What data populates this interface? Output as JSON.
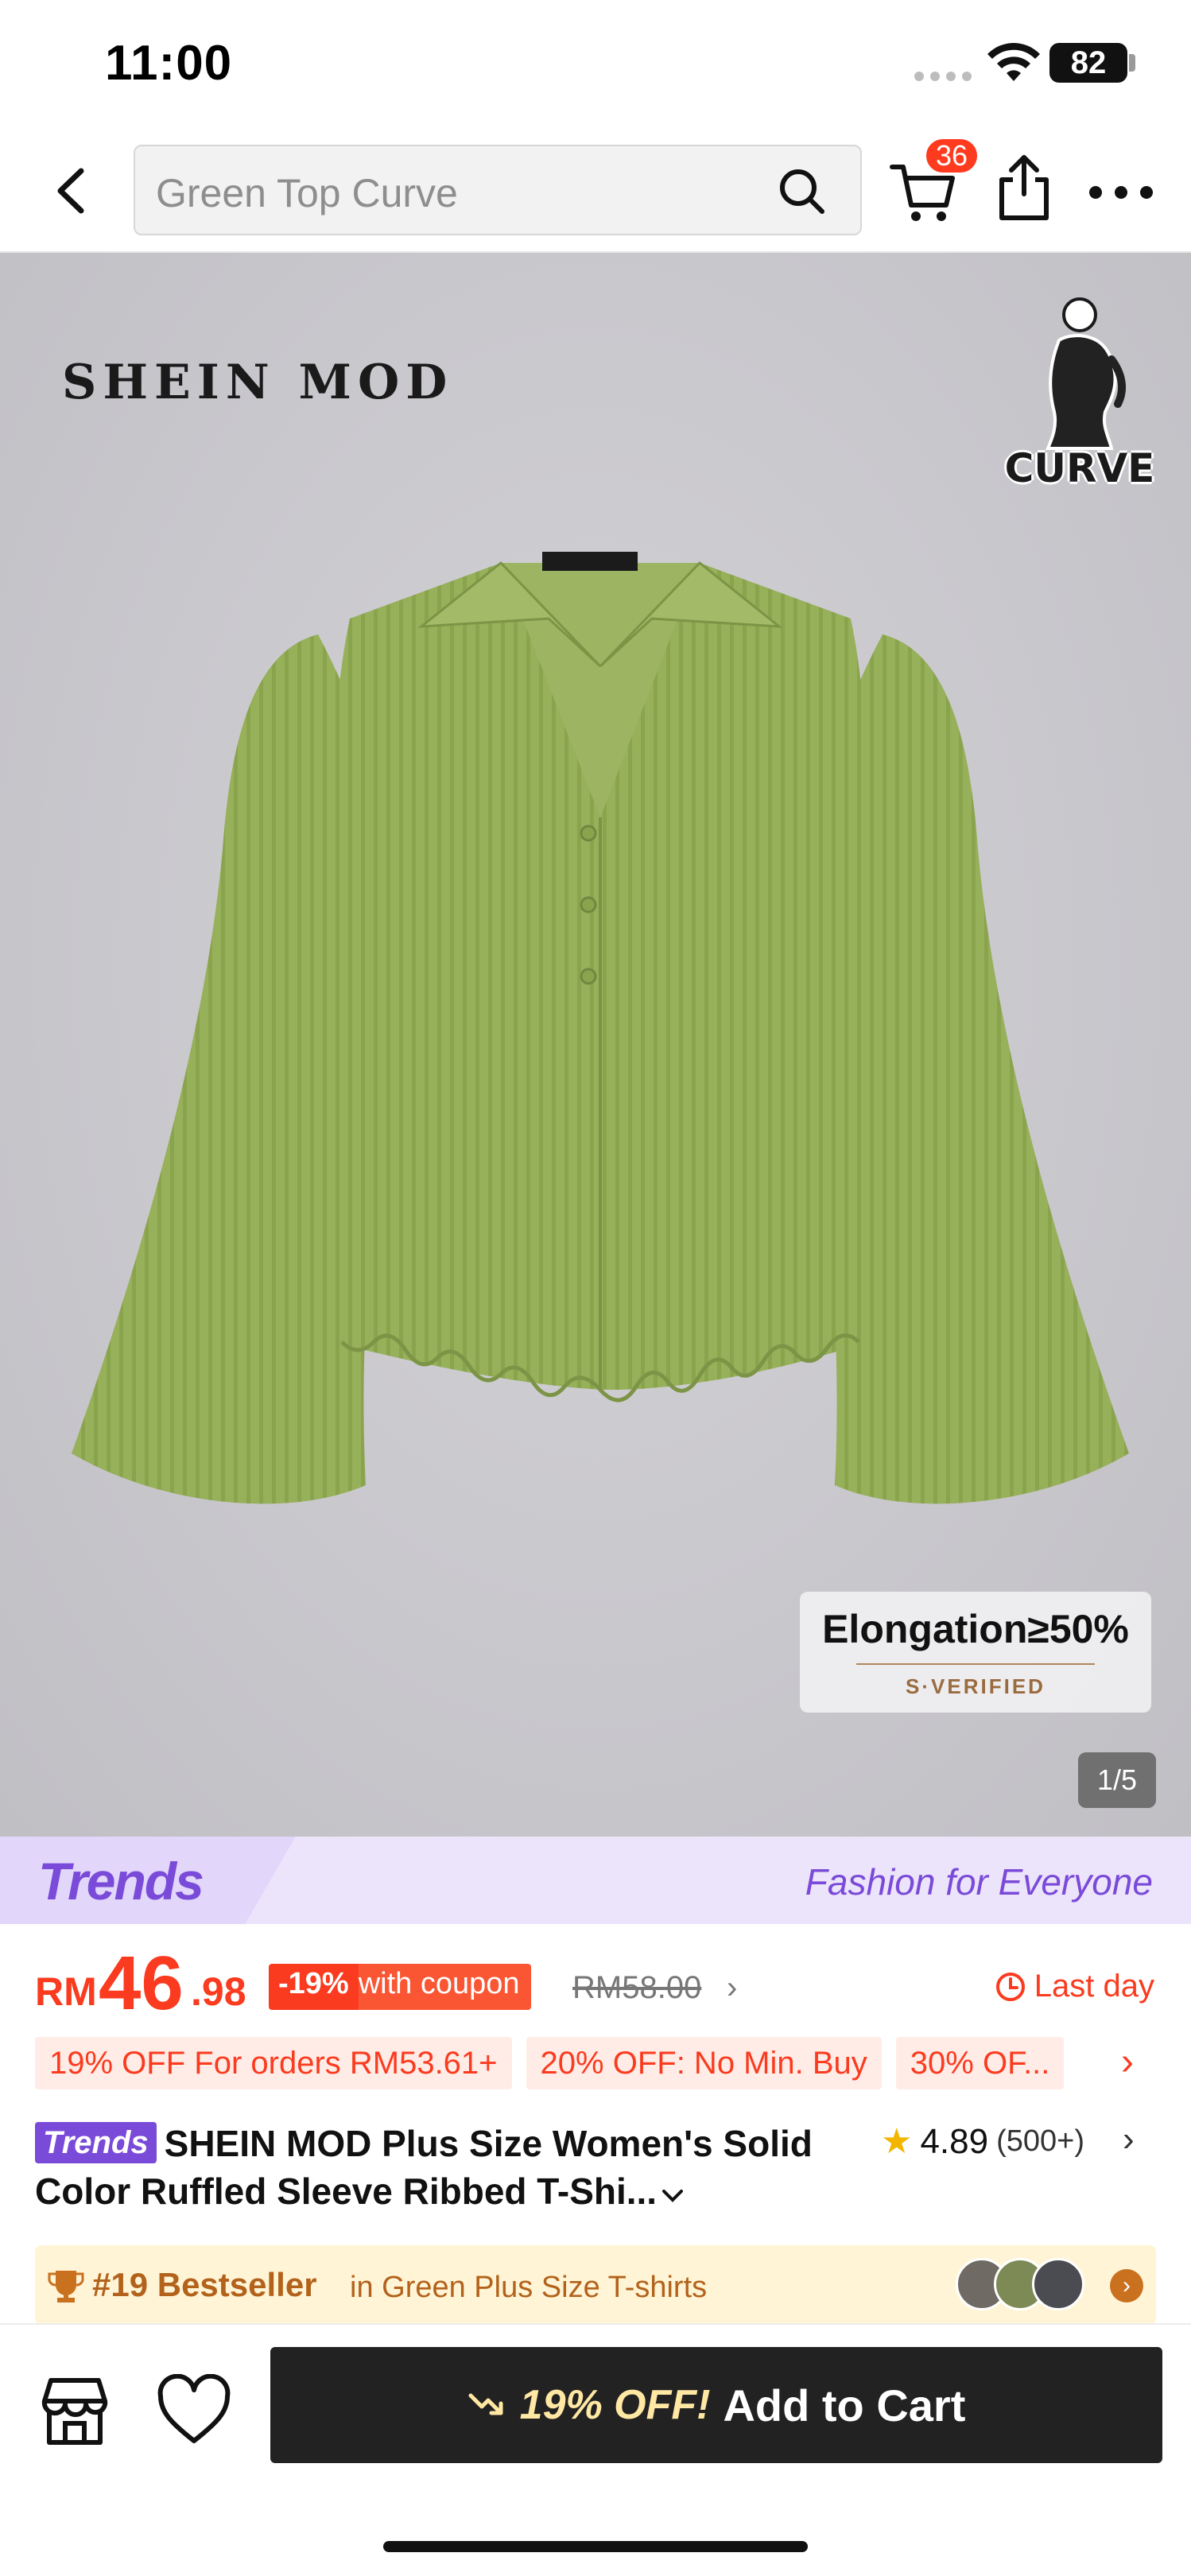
{
  "status_bar": {
    "time": "11:00",
    "battery": "82"
  },
  "nav": {
    "search_placeholder": "Green Top Curve",
    "cart_count": "36"
  },
  "gallery": {
    "brand_logo": "SHEIN MOD",
    "curve_label": "CURVE",
    "elongation_title": "Elongation≥50%",
    "elongation_sub": "S·VERIFIED",
    "counter": "1/5",
    "product_color": "#97b05a"
  },
  "trends": {
    "logo": "Trends",
    "slogan": "Fashion for Everyone"
  },
  "price": {
    "currency": "RM",
    "integer": "46",
    "decimal": ".98",
    "coupon_pct": "-19%",
    "coupon_text": "with coupon",
    "original": "RM58.00",
    "last_day": "Last day"
  },
  "chips": [
    "19% OFF For orders RM53.61+",
    "20% OFF: No Min. Buy",
    "30% OF..."
  ],
  "title": {
    "tag": "Trends",
    "text": "SHEIN MOD Plus Size Women's Solid Color Ruffled Sleeve Ribbed T-Shi..."
  },
  "rating": {
    "score": "4.89",
    "count": "(500+)"
  },
  "bestseller": {
    "rank": "#19 Bestseller",
    "category": "in Green Plus Size T-shirts"
  },
  "bottom": {
    "promo": "19% OFF!",
    "add_to_cart": "Add to Cart"
  },
  "colors": {
    "accent": "#fa3b1f",
    "trends_purple": "#7a4ad8",
    "cta_dark": "#222222"
  }
}
